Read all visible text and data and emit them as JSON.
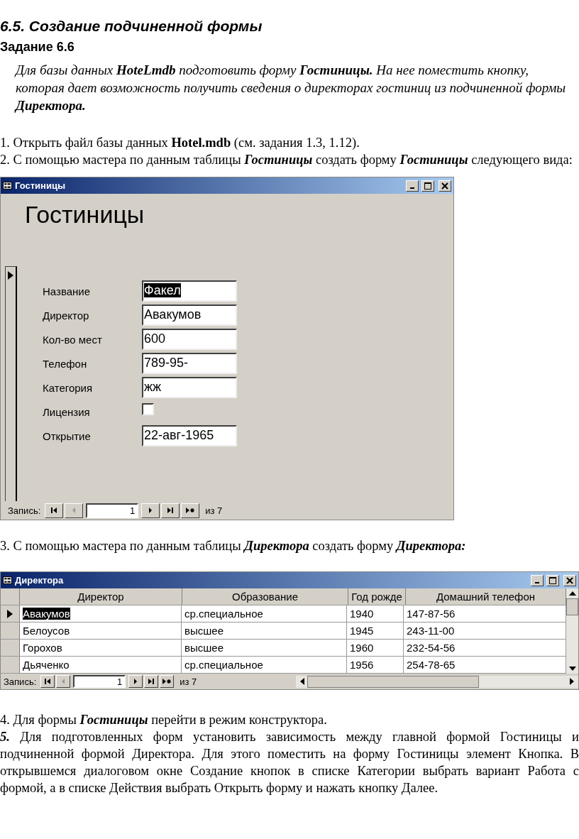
{
  "blocks": [
    {
      "kind": "heading",
      "text": "6.5. Создание подчиненной формы"
    },
    {
      "kind": "subheading",
      "text": "Задание 6.6"
    },
    {
      "kind": "note",
      "text": "Для базы данных **HoteLmdb** подготовить форму **Гостиницы.** На нее поместить кнопку, которая дает возможность получить сведения о директорах гостиниц из подчиненной формы **Директора.**"
    },
    {
      "kind": "paragraph",
      "text": "1. Открыть файл базы данных **Hotel.mdb** (см. задания 1.3, 1.12)."
    },
    {
      "kind": "paragraph",
      "text": "2. С помощью мастера по данным таблицы *Гостиницы* создать форму *Гостиницы* следующего вида:"
    },
    {
      "kind": "form_window",
      "title": "Гостиницы",
      "form_title": "Гостиницы",
      "fields": [
        {
          "kind": "text",
          "label": "Название",
          "value": "Факел",
          "selected": true
        },
        {
          "kind": "text",
          "label": "Директор",
          "value": "Авакумов",
          "selected": false
        },
        {
          "kind": "text",
          "label": "Кол-во мест",
          "value": "600",
          "selected": false
        },
        {
          "kind": "text",
          "label": "Телефон",
          "value": "789-95-",
          "selected": false
        },
        {
          "kind": "text",
          "label": "Категория",
          "value": "жж",
          "selected": false
        },
        {
          "kind": "checkbox",
          "label": "Лицензия",
          "checked": false
        },
        {
          "kind": "text",
          "label": "Открытие",
          "value": "22-авг-1965",
          "selected": false
        }
      ],
      "navigator": {
        "label": "Запись:",
        "current": "1",
        "total": "из 7"
      }
    },
    {
      "kind": "paragraph",
      "text": "3. С помощью мастера по данным таблицы *Директора* создать форму *Директора:*"
    },
    {
      "kind": "table_window",
      "title": "Директора",
      "columns": [
        "Директор",
        "Образование",
        "Год рожде",
        "Домашний телефон"
      ],
      "rows": [
        {
          "selected": true,
          "cells": [
            "Авакумов",
            "ср.специальное",
            "1940",
            "147-87-56"
          ]
        },
        {
          "selected": false,
          "cells": [
            "Белоусов",
            "высшее",
            "1945",
            "243-11-00"
          ]
        },
        {
          "selected": false,
          "cells": [
            "Горохов",
            "высшее",
            "1960",
            "232-54-56"
          ]
        },
        {
          "selected": false,
          "cells": [
            "Дьяченко",
            "ср.специальное",
            "1956",
            "254-78-65"
          ]
        }
      ],
      "navigator": {
        "label": "Запись:",
        "current": "1",
        "total": "из 7"
      }
    },
    {
      "kind": "paragraph",
      "text": "4. Для формы *Гостиницы* перейти в режим конструктора."
    },
    {
      "kind": "paragraph",
      "text": "*5.* Для подготовленных форм установить зависимость между главной формой Гостиницы и подчиненной формой Директора. Для этого поместить на форму Гостиницы элемент Кнопка. В открывшемся диалоговом окне Создание кнопок в списке Категории выбрать вариант Работа с формой, а в списке Действия выбрать Открыть форму и нажать кнопку Далее."
    }
  ]
}
